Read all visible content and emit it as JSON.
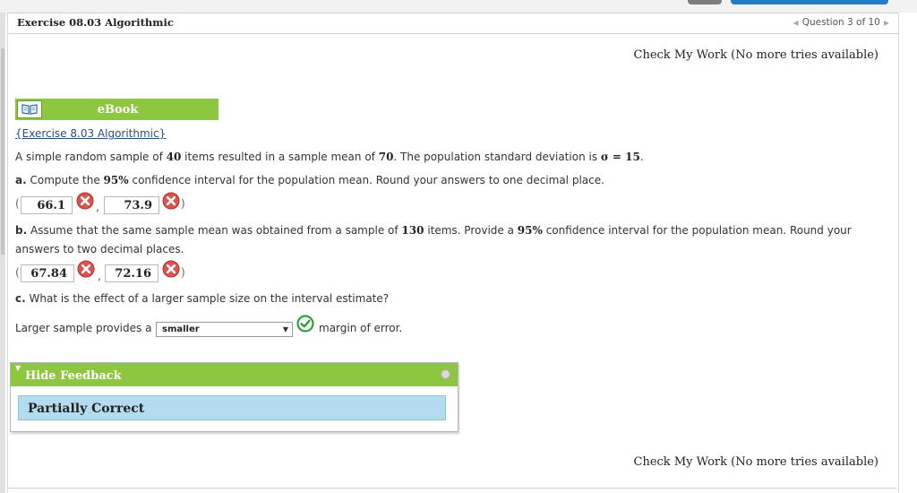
{
  "exercise_title": "Exercise 08.03 Algorithmic",
  "question_nav": {
    "text": "Question 3 of 10"
  },
  "check_my_work": "Check My Work (No more tries available)",
  "ebook": {
    "label": "eBook",
    "link_text": "{Exercise 8.03 Algorithmic}"
  },
  "problem": {
    "intro_pre": "A simple random sample of",
    "n": "40",
    "intro_mid1": "items resulted in a sample mean of",
    "mean": "70",
    "intro_mid2": ". The population standard deviation is",
    "sigma_expr": "σ = 15",
    "intro_end": "."
  },
  "part_a": {
    "label": "a.",
    "pre": "Compute the",
    "conf": "95%",
    "post": "confidence interval for the population mean. Round your answers to one decimal place.",
    "lower": "66.1",
    "upper": "73.9"
  },
  "part_b": {
    "label": "b.",
    "pre": "Assume that the same sample mean was obtained from a sample of",
    "n": "130",
    "mid": "items. Provide a",
    "conf": "95%",
    "post": "confidence interval for the population mean. Round your",
    "line2": "answers to two decimal places.",
    "lower": "67.84",
    "upper": "72.16"
  },
  "part_c": {
    "label": "c.",
    "question": "What is the effect of a larger sample size on the interval estimate?",
    "pre": "Larger sample provides a",
    "selected": "smaller",
    "post": "margin of error."
  },
  "feedback": {
    "toggle_label": "Hide Feedback",
    "status": "Partially Correct"
  },
  "colors": {
    "green": "#8dc63f",
    "error_red": "#d9534f",
    "correct_green": "#2f9e3c",
    "feedback_blue": "#b3dcef"
  },
  "icons": {
    "incorrect": "x-circle-icon",
    "correct": "check-circle-icon",
    "ebook": "book-icon"
  }
}
